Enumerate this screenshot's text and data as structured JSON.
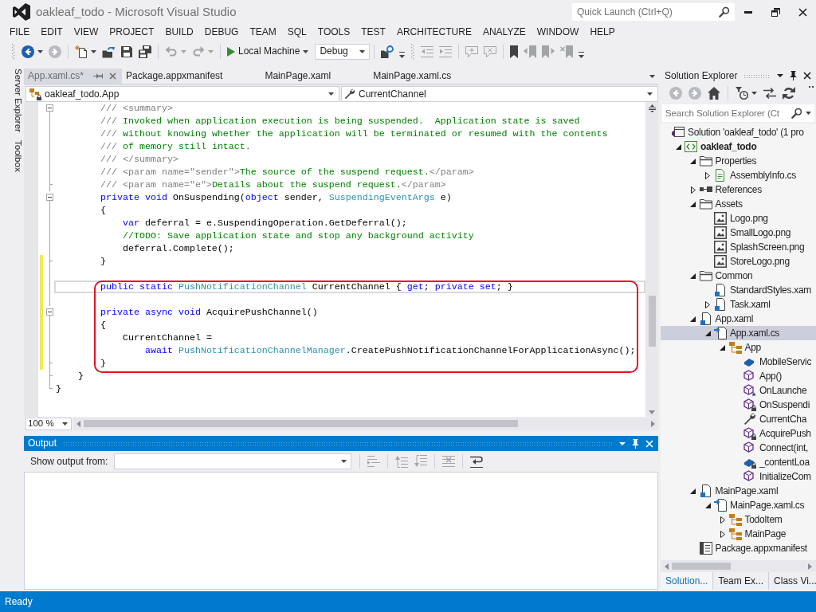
{
  "window": {
    "title": "oakleaf_todo - Microsoft Visual Studio"
  },
  "quick_launch": {
    "placeholder": "Quick Launch (Ctrl+Q)"
  },
  "menu": [
    "FILE",
    "EDIT",
    "VIEW",
    "PROJECT",
    "BUILD",
    "DEBUG",
    "TEAM",
    "SQL",
    "TOOLS",
    "TEST",
    "ARCHITECTURE",
    "ANALYZE",
    "WINDOW",
    "HELP"
  ],
  "toolbar": [
    {
      "kind": "grip"
    },
    {
      "kind": "back",
      "disabled": false,
      "dropdown": true
    },
    {
      "kind": "forward",
      "disabled": true
    },
    {
      "kind": "separator"
    },
    {
      "kind": "newproject",
      "disabled": false,
      "dropdown": true
    },
    {
      "kind": "open",
      "disabled": false
    },
    {
      "kind": "save",
      "disabled": false
    },
    {
      "kind": "saveall",
      "disabled": false
    },
    {
      "kind": "separator"
    },
    {
      "kind": "undo",
      "disabled": true,
      "dropdown": true
    },
    {
      "kind": "redo",
      "disabled": true,
      "dropdown": true
    },
    {
      "kind": "separator"
    },
    {
      "kind": "run",
      "label": "Local Machine",
      "disabled": false,
      "dropdown": true
    },
    {
      "kind": "combo",
      "value": "Debug"
    },
    {
      "kind": "separator"
    },
    {
      "kind": "find",
      "disabled": false
    },
    {
      "kind": "overflow"
    },
    {
      "kind": "grip"
    },
    {
      "kind": "outdent",
      "disabled": true
    },
    {
      "kind": "indent",
      "disabled": true
    },
    {
      "kind": "separator"
    },
    {
      "kind": "comment",
      "disabled": true
    },
    {
      "kind": "uncomment",
      "disabled": true
    },
    {
      "kind": "separator"
    },
    {
      "kind": "bookmark",
      "disabled": false
    },
    {
      "kind": "prevbookmark",
      "disabled": true
    },
    {
      "kind": "nextbookmark",
      "disabled": true
    },
    {
      "kind": "clearbookmarks",
      "disabled": true
    },
    {
      "kind": "overflow"
    }
  ],
  "side_tabs": [
    "Server Explorer",
    "Toolbox"
  ],
  "document_tabs": [
    {
      "label": "App.xaml.cs*",
      "selected": true
    },
    {
      "label": "Package.appxmanifest",
      "selected": false
    },
    {
      "label": "MainPage.xaml",
      "selected": false
    },
    {
      "label": "MainPage.xaml.cs",
      "selected": false
    }
  ],
  "navigation": {
    "type": "oakleaf_todo.App",
    "member": "CurrentChannel"
  },
  "editor": {
    "blocks": [
      {
        "boxed": false,
        "lines": [
          {
            "changed": false,
            "current": false,
            "outline_start": true,
            "outline_end": false,
            "tokens": [
              {
                "kind": "doc",
                "text": "        /// <summary>"
              }
            ]
          },
          {
            "changed": false,
            "current": false,
            "outline_start": false,
            "outline_end": false,
            "tokens": [
              {
                "kind": "doc",
                "text": "        ///"
              },
              {
                "kind": "comment",
                "text": " Invoked when application execution is being suspended.  Application state is saved"
              }
            ]
          },
          {
            "changed": false,
            "current": false,
            "outline_start": false,
            "outline_end": false,
            "tokens": [
              {
                "kind": "doc",
                "text": "        ///"
              },
              {
                "kind": "comment",
                "text": " without knowing whether the application will be terminated or resumed with the contents"
              }
            ]
          },
          {
            "changed": false,
            "current": false,
            "outline_start": false,
            "outline_end": false,
            "tokens": [
              {
                "kind": "doc",
                "text": "        ///"
              },
              {
                "kind": "comment",
                "text": " of memory still intact."
              }
            ]
          },
          {
            "changed": false,
            "current": false,
            "outline_start": false,
            "outline_end": false,
            "tokens": [
              {
                "kind": "doc",
                "text": "        /// </summary>"
              }
            ]
          },
          {
            "changed": false,
            "current": false,
            "outline_start": false,
            "outline_end": false,
            "tokens": [
              {
                "kind": "doc",
                "text": "        /// <param name=\"sender\">"
              },
              {
                "kind": "comment",
                "text": "The source of the suspend request."
              },
              {
                "kind": "doc",
                "text": "</param>"
              }
            ]
          },
          {
            "changed": false,
            "current": false,
            "outline_start": false,
            "outline_end": true,
            "tokens": [
              {
                "kind": "doc",
                "text": "        /// <param name=\"e\">"
              },
              {
                "kind": "comment",
                "text": "Details about the suspend request."
              },
              {
                "kind": "doc",
                "text": "</param>"
              }
            ]
          },
          {
            "changed": false,
            "current": false,
            "outline_start": true,
            "outline_end": false,
            "tokens": [
              {
                "kind": "keyword",
                "text": "        private void"
              },
              {
                "kind": "plain",
                "text": " OnSuspending("
              },
              {
                "kind": "keyword",
                "text": "object"
              },
              {
                "kind": "plain",
                "text": " sender, "
              },
              {
                "kind": "type",
                "text": "SuspendingEventArgs"
              },
              {
                "kind": "plain",
                "text": " e)"
              }
            ]
          },
          {
            "changed": false,
            "current": false,
            "outline_start": false,
            "outline_end": false,
            "tokens": [
              {
                "kind": "plain",
                "text": "        {"
              }
            ]
          },
          {
            "changed": false,
            "current": false,
            "outline_start": false,
            "outline_end": false,
            "tokens": [
              {
                "kind": "keyword",
                "text": "            var"
              },
              {
                "kind": "plain",
                "text": " deferral = e.SuspendingOperation.GetDeferral();"
              }
            ]
          },
          {
            "changed": false,
            "current": false,
            "outline_start": false,
            "outline_end": false,
            "tokens": [
              {
                "kind": "comment",
                "text": "            //TODO: Save application state and stop any background activity"
              }
            ]
          },
          {
            "changed": false,
            "current": false,
            "outline_start": false,
            "outline_end": false,
            "tokens": [
              {
                "kind": "plain",
                "text": "            deferral.Complete();"
              }
            ]
          },
          {
            "changed": true,
            "current": false,
            "outline_start": false,
            "outline_end": true,
            "tokens": [
              {
                "kind": "plain",
                "text": "        }"
              }
            ]
          },
          {
            "changed": true,
            "current": false,
            "outline_start": false,
            "outline_end": false
          }
        ]
      },
      {
        "boxed": true,
        "lines": [
          {
            "changed": true,
            "current": true,
            "outline_start": false,
            "outline_end": false,
            "tokens": [
              {
                "kind": "keyword",
                "text": "        public static"
              },
              {
                "kind": "type",
                "text": " PushNotificationChannel"
              },
              {
                "kind": "plain",
                "text": " CurrentChannel { "
              },
              {
                "kind": "keyword",
                "text": "get"
              },
              {
                "kind": "plain",
                "text": "; "
              },
              {
                "kind": "keyword",
                "text": "private set"
              },
              {
                "kind": "plain",
                "text": "; }"
              }
            ]
          },
          {
            "changed": true,
            "current": false,
            "outline_start": false,
            "outline_end": false
          },
          {
            "changed": true,
            "current": false,
            "outline_start": true,
            "outline_end": false,
            "tokens": [
              {
                "kind": "keyword",
                "text": "        private async void"
              },
              {
                "kind": "plain",
                "text": " AcquirePushChannel()"
              }
            ]
          },
          {
            "changed": true,
            "current": false,
            "outline_start": false,
            "outline_end": false,
            "tokens": [
              {
                "kind": "plain",
                "text": "        {"
              }
            ]
          },
          {
            "changed": true,
            "current": false,
            "outline_start": false,
            "outline_end": false,
            "tokens": [
              {
                "kind": "plain",
                "text": "            CurrentChannel ="
              }
            ]
          },
          {
            "changed": true,
            "current": false,
            "outline_start": false,
            "outline_end": false,
            "tokens": [
              {
                "kind": "keyword",
                "text": "                await"
              },
              {
                "kind": "type",
                "text": " PushNotificationChannelManager"
              },
              {
                "kind": "plain",
                "text": ".CreatePushNotificationChannelForApplicationAsync();"
              }
            ]
          },
          {
            "changed": true,
            "current": false,
            "outline_start": false,
            "outline_end": true,
            "tokens": [
              {
                "kind": "plain",
                "text": "        }"
              }
            ]
          }
        ]
      },
      {
        "boxed": false,
        "lines": [
          {
            "changed": false,
            "current": false,
            "outline_start": false,
            "outline_end": true,
            "tokens": [
              {
                "kind": "plain",
                "text": "    }"
              }
            ]
          },
          {
            "changed": false,
            "current": false,
            "outline_start": false,
            "outline_end": true,
            "tokens": [
              {
                "kind": "plain",
                "text": "}"
              }
            ]
          }
        ]
      }
    ],
    "zoom": "100 %"
  },
  "output": {
    "title": "Output",
    "source_label": "Show output from:",
    "toolbar": [
      {
        "kind": "separator"
      },
      {
        "kind": "findmessage",
        "disabled": true
      },
      {
        "kind": "separator"
      },
      {
        "kind": "prevmessage",
        "disabled": true
      },
      {
        "kind": "nextmessage",
        "disabled": true
      },
      {
        "kind": "separator"
      },
      {
        "kind": "clearall",
        "disabled": true
      },
      {
        "kind": "separator"
      },
      {
        "kind": "wordwrap",
        "disabled": false
      }
    ]
  },
  "solution_explorer": {
    "title": "Solution Explorer",
    "toolbar": [
      {
        "kind": "back",
        "disabled": true
      },
      {
        "kind": "forward",
        "disabled": true
      },
      {
        "kind": "home",
        "disabled": false
      },
      {
        "kind": "separator"
      },
      {
        "kind": "pending",
        "disabled": false,
        "dropdown": true
      },
      {
        "kind": "sync",
        "disabled": false
      },
      {
        "kind": "refresh",
        "disabled": false
      },
      {
        "kind": "more"
      }
    ],
    "search": {
      "placeholder": "Search Solution Explorer (Ct"
    },
    "tree": [
      {
        "label": "Solution 'oakleaf_todo' (1 pro",
        "kind": "solution",
        "selected": false,
        "children": [
          {
            "label": "oakleaf_todo",
            "kind": "project",
            "expanded": true,
            "selected": false,
            "children": [
              {
                "label": "Properties",
                "kind": "folder",
                "expanded": true,
                "selected": false,
                "children": [
                  {
                    "label": "AssemblyInfo.cs",
                    "kind": "csfile",
                    "expanded": false,
                    "selected": false
                  }
                ]
              },
              {
                "label": "References",
                "kind": "references",
                "expanded": false,
                "selected": false
              },
              {
                "label": "Assets",
                "kind": "folder",
                "expanded": true,
                "selected": false,
                "children": [
                  {
                    "label": "Logo.png",
                    "kind": "image",
                    "selected": false
                  },
                  {
                    "label": "SmallLogo.png",
                    "kind": "image",
                    "selected": false
                  },
                  {
                    "label": "SplashScreen.png",
                    "kind": "image",
                    "selected": false
                  },
                  {
                    "label": "StoreLogo.png",
                    "kind": "image",
                    "selected": false
                  }
                ]
              },
              {
                "label": "Common",
                "kind": "folder",
                "expanded": true,
                "selected": false,
                "children": [
                  {
                    "label": "StandardStyles.xam",
                    "kind": "xaml",
                    "selected": false
                  },
                  {
                    "label": "Task.xaml",
                    "kind": "xaml",
                    "expanded": false,
                    "selected": false
                  }
                ]
              },
              {
                "label": "App.xaml",
                "kind": "xaml",
                "expanded": true,
                "selected": false,
                "children": [
                  {
                    "label": "App.xaml.cs",
                    "kind": "codefile",
                    "expanded": true,
                    "selected": true,
                    "children": [
                      {
                        "label": "App",
                        "kind": "class",
                        "expanded": true,
                        "selected": false,
                        "children": [
                          {
                            "label": "MobileServic",
                            "kind": "field",
                            "selected": false
                          },
                          {
                            "label": "App()",
                            "kind": "method",
                            "selected": false
                          },
                          {
                            "label": "OnLaunche",
                            "kind": "protectedmethod",
                            "selected": false
                          },
                          {
                            "label": "OnSuspendi",
                            "kind": "privatemethod",
                            "selected": false
                          },
                          {
                            "label": "CurrentCha",
                            "kind": "property",
                            "selected": false
                          },
                          {
                            "label": "AcquirePush",
                            "kind": "privatemethod",
                            "selected": false
                          },
                          {
                            "label": "Connect(int,",
                            "kind": "method",
                            "selected": false
                          },
                          {
                            "label": "_contentLoa",
                            "kind": "privatefield",
                            "selected": false
                          },
                          {
                            "label": "InitializeCom",
                            "kind": "method",
                            "selected": false
                          }
                        ]
                      }
                    ]
                  }
                ]
              },
              {
                "label": "MainPage.xaml",
                "kind": "xaml",
                "expanded": true,
                "selected": false,
                "children": [
                  {
                    "label": "MainPage.xaml.cs",
                    "kind": "codefile",
                    "expanded": true,
                    "selected": false,
                    "children": [
                      {
                        "label": "TodoItem",
                        "kind": "class",
                        "expanded": false,
                        "selected": false
                      },
                      {
                        "label": "MainPage",
                        "kind": "class",
                        "expanded": false,
                        "selected": false
                      }
                    ]
                  }
                ]
              },
              {
                "label": "Package.appxmanifest",
                "kind": "manifest",
                "selected": false
              }
            ]
          }
        ]
      }
    ],
    "tabs": [
      {
        "label": "Solution...",
        "selected": true
      },
      {
        "label": "Team Ex...",
        "selected": false
      },
      {
        "label": "Class Vi...",
        "selected": false
      }
    ]
  },
  "status_bar": {
    "text": "Ready"
  }
}
